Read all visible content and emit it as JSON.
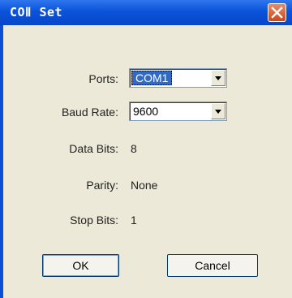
{
  "window": {
    "title": "COⅡ Set"
  },
  "fields": {
    "ports": {
      "label": "Ports:",
      "value": "COM1"
    },
    "baud_rate": {
      "label": "Baud Rate:",
      "value": "9600"
    },
    "data_bits": {
      "label": "Data Bits:",
      "value": "8"
    },
    "parity": {
      "label": "Parity:",
      "value": "None"
    },
    "stop_bits": {
      "label": "Stop Bits:",
      "value": "1"
    }
  },
  "buttons": {
    "ok": "OK",
    "cancel": "Cancel"
  },
  "icons": {
    "close": "close-icon",
    "dropdown": "chevron-down-icon"
  }
}
